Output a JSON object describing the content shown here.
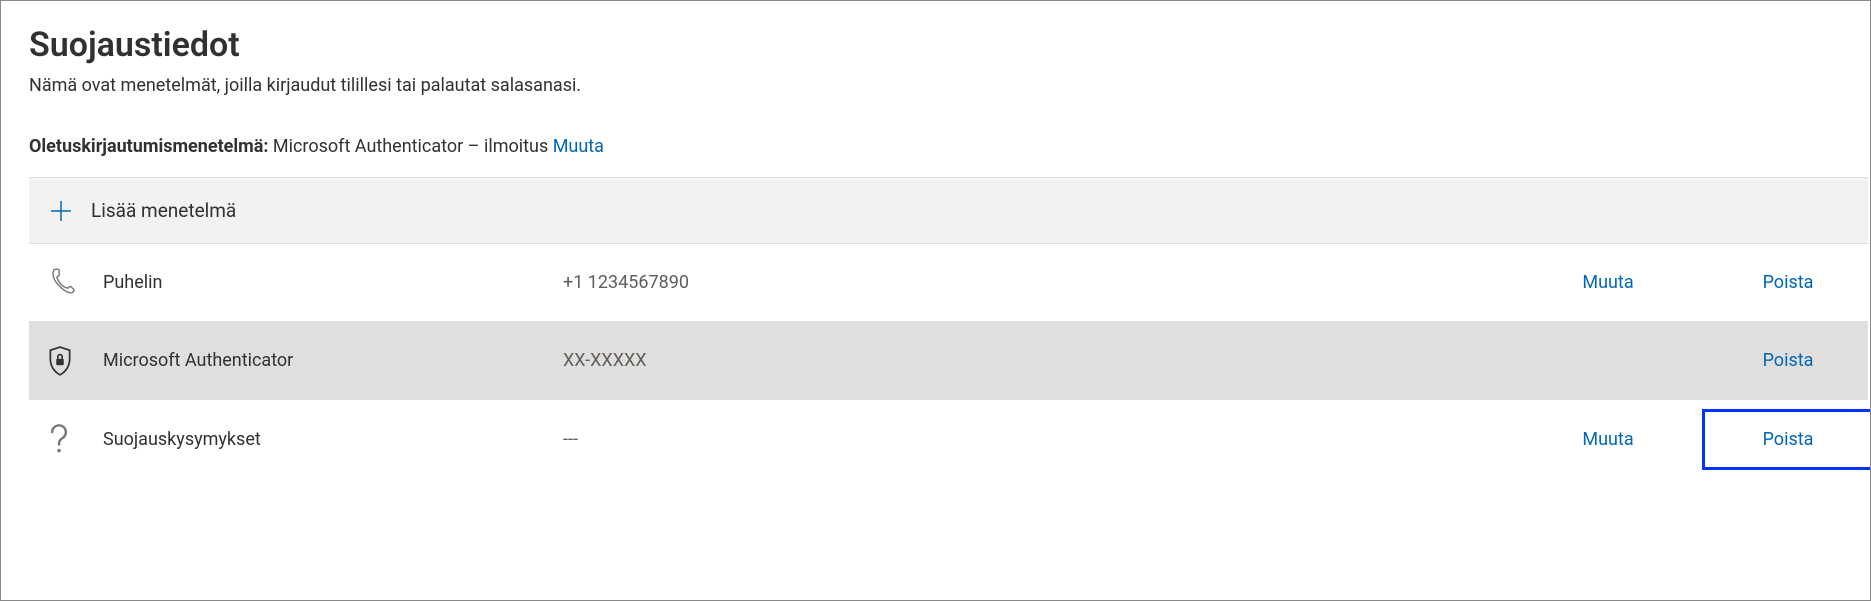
{
  "header": {
    "title": "Suojaustiedot",
    "subtitle": "Nämä ovat menetelmät, joilla kirjaudut tilillesi tai palautat salasanasi."
  },
  "default_method": {
    "label": "Oletuskirjautumismenetelmä:",
    "value": "Microsoft Authenticator – ilmoitus",
    "change_label": "Muuta"
  },
  "add_method": {
    "label": "Lisää menetelmä"
  },
  "methods": [
    {
      "icon": "phone-icon",
      "name": "Puhelin",
      "value": "+1 1234567890",
      "change_label": "Muuta",
      "delete_label": "Poista"
    },
    {
      "icon": "lock-icon",
      "name": "Microsoft Authenticator",
      "value": "XX-XXXXX",
      "change_label": "",
      "delete_label": "Poista"
    },
    {
      "icon": "question-icon",
      "name": "Suojauskysymykset",
      "value": "---",
      "change_label": "Muuta",
      "delete_label": "Poista"
    }
  ]
}
